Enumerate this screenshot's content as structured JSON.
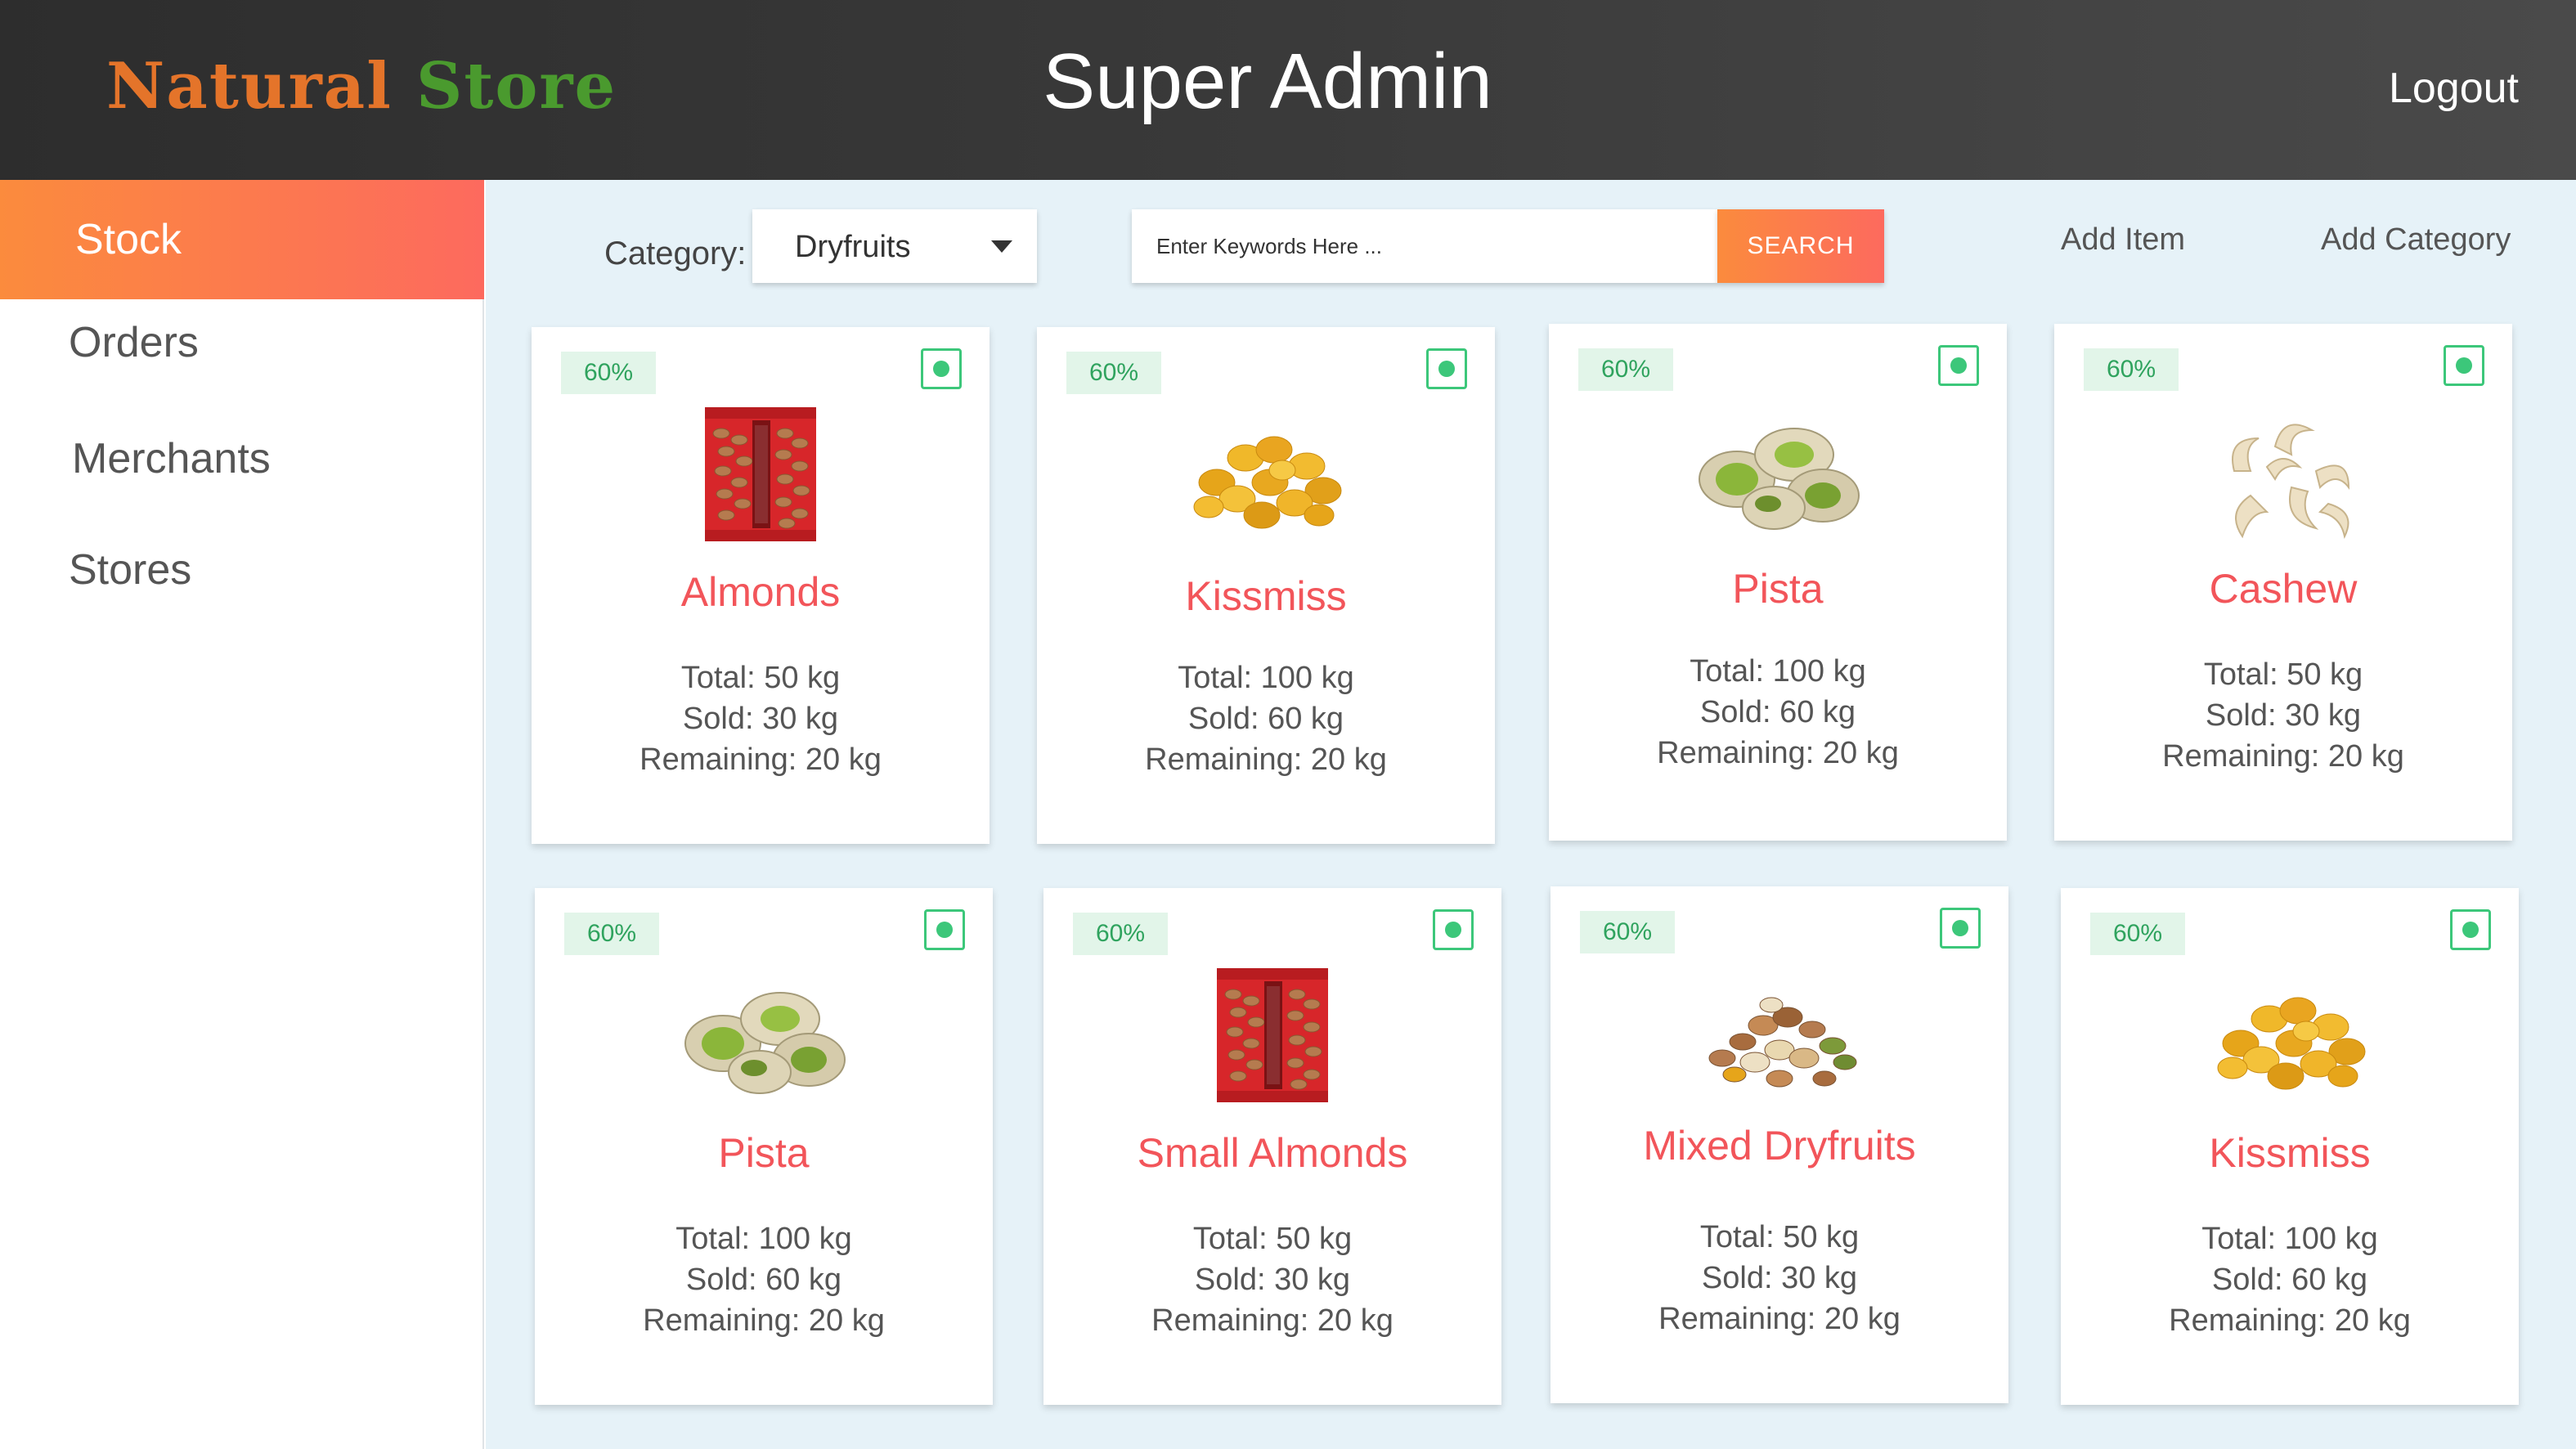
{
  "header": {
    "logo_word1": "Natural",
    "logo_word2": "Store",
    "title": "Super Admin",
    "logout_label": "Logout"
  },
  "sidebar": {
    "items": [
      {
        "label": "Stock",
        "active": true
      },
      {
        "label": "Orders",
        "active": false
      },
      {
        "label": "Merchants",
        "active": false
      },
      {
        "label": "Stores",
        "active": false
      }
    ]
  },
  "toolbar": {
    "category_label": "Category:",
    "category_value": "Dryfruits",
    "search_placeholder": "Enter Keywords Here ...",
    "search_button": "SEARCH",
    "add_item": "Add Item",
    "add_category": "Add Category"
  },
  "products": [
    {
      "badge": "60%",
      "name": "Almonds",
      "image": "almonds-bag",
      "total": "Total: 50 kg",
      "sold": "Sold: 30 kg",
      "remaining": "Remaining: 20 kg"
    },
    {
      "badge": "60%",
      "name": "Kissmiss",
      "image": "raisins",
      "total": "Total: 100 kg",
      "sold": "Sold: 60 kg",
      "remaining": "Remaining: 20 kg"
    },
    {
      "badge": "60%",
      "name": "Pista",
      "image": "pistachios",
      "total": "Total: 100 kg",
      "sold": "Sold: 60 kg",
      "remaining": "Remaining: 20 kg"
    },
    {
      "badge": "60%",
      "name": "Cashew",
      "image": "cashews",
      "total": "Total: 50 kg",
      "sold": "Sold: 30 kg",
      "remaining": "Remaining: 20 kg"
    },
    {
      "badge": "60%",
      "name": "Pista",
      "image": "pistachios",
      "total": "Total: 100 kg",
      "sold": "Sold: 60 kg",
      "remaining": "Remaining: 20 kg"
    },
    {
      "badge": "60%",
      "name": "Small Almonds",
      "image": "almonds-bag",
      "total": "Total: 50 kg",
      "sold": "Sold: 30 kg",
      "remaining": "Remaining: 20 kg"
    },
    {
      "badge": "60%",
      "name": "Mixed Dryfruits",
      "image": "mixed-nuts",
      "total": "Total: 50 kg",
      "sold": "Sold: 30 kg",
      "remaining": "Remaining: 20 kg"
    },
    {
      "badge": "60%",
      "name": "Kissmiss",
      "image": "raisins",
      "total": "Total: 100 kg",
      "sold": "Sold: 60 kg",
      "remaining": "Remaining: 20 kg"
    }
  ],
  "colors": {
    "accent_start": "#fb8b3d",
    "accent_end": "#fd6a5e",
    "product_name": "#f2555a",
    "status_green": "#3cc77a",
    "main_bg": "#e6f2f8"
  }
}
